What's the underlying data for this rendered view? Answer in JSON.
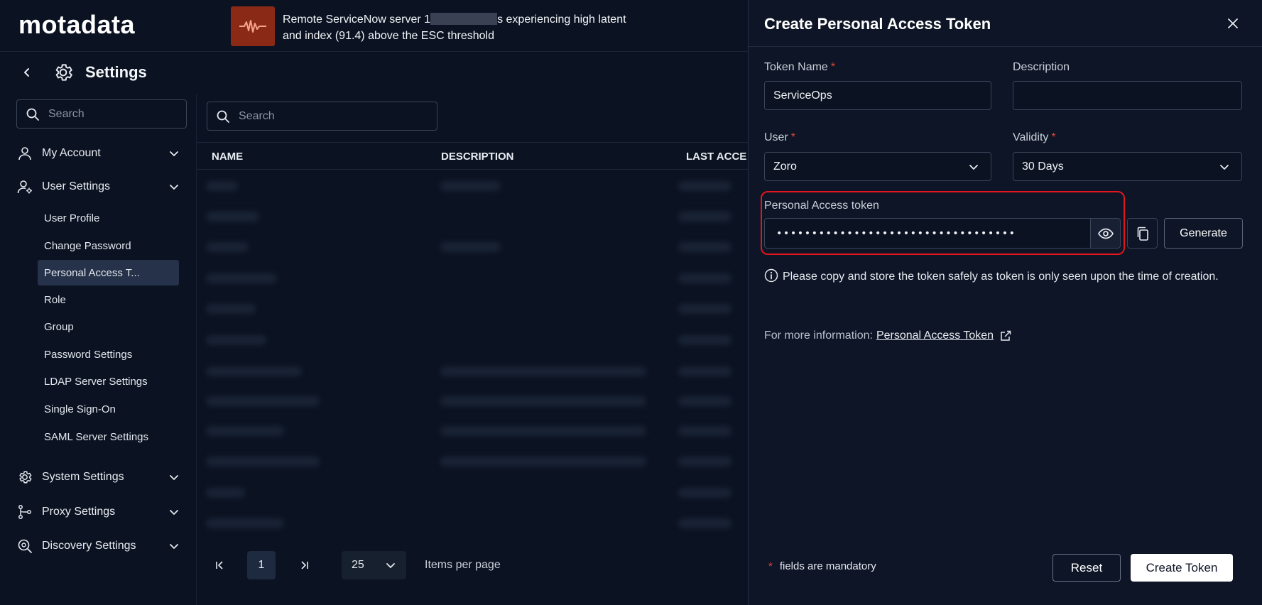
{
  "brand": {
    "logo": "motadata"
  },
  "alert": {
    "line1_start": "Remote ServiceNow server 1",
    "line1_end": "s experiencing high latent",
    "line2": "and index (91.4) above the ESC threshold"
  },
  "settings": {
    "title": "Settings",
    "search_placeholder": "Search"
  },
  "nav": {
    "groups": [
      {
        "label": "My Account"
      },
      {
        "label": "User Settings"
      },
      {
        "label": "System Settings"
      },
      {
        "label": "Proxy Settings"
      },
      {
        "label": "Discovery Settings"
      }
    ],
    "user_settings_items": [
      {
        "label": "User Profile"
      },
      {
        "label": "Change Password"
      },
      {
        "label": "Personal Access T..."
      },
      {
        "label": "Role"
      },
      {
        "label": "Group"
      },
      {
        "label": "Password Settings"
      },
      {
        "label": "LDAP Server Settings"
      },
      {
        "label": "Single Sign-On"
      },
      {
        "label": "SAML Server Settings"
      }
    ]
  },
  "list": {
    "search_placeholder": "Search",
    "columns": [
      "NAME",
      "DESCRIPTION",
      "LAST ACCE"
    ]
  },
  "pagination": {
    "current_page": "1",
    "per_page": "25",
    "items_per_page_label": "Items per page"
  },
  "drawer": {
    "title": "Create Personal Access Token",
    "token_name": {
      "label": "Token Name",
      "value": "ServiceOps"
    },
    "description": {
      "label": "Description",
      "value": ""
    },
    "user": {
      "label": "User",
      "value": "Zoro"
    },
    "validity": {
      "label": "Validity",
      "value": "30 Days"
    },
    "token": {
      "label": "Personal Access token",
      "masked_value": "••••••••••••••••••••••••••••••••••"
    },
    "generate_label": "Generate",
    "info_text": "Please copy and store the token safely as token is only seen upon the time of creation.",
    "more_info_label": "For more information:",
    "more_info_link": "Personal Access Token",
    "mandatory_note": "fields are mandatory",
    "required_marker": "*",
    "reset_label": "Reset",
    "create_label": "Create Token"
  },
  "colors": {
    "background": "#0b1322",
    "drawer_bg": "#0d1526",
    "highlight": "#e2161c",
    "required": "#e0453a",
    "alert_icon": "#8a2a16"
  }
}
